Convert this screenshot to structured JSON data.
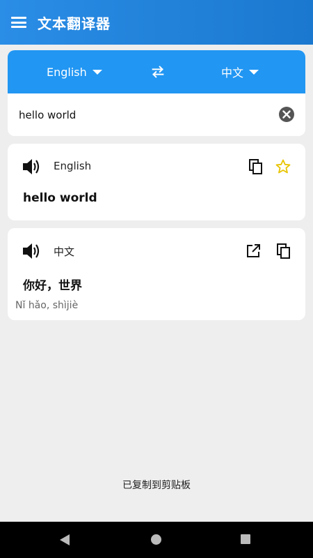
{
  "appbar": {
    "title": "文本翻译器",
    "menu_icon": "menu-icon"
  },
  "languages": {
    "source": "English",
    "target": "中文",
    "swap_icon": "swap-arrows-icon"
  },
  "input": {
    "value": "hello world",
    "clear_icon": "clear-icon"
  },
  "source_result": {
    "language": "English",
    "text": "hello world",
    "icons": [
      "speaker-icon",
      "copy-icon",
      "star-icon"
    ]
  },
  "target_result": {
    "language": "中文",
    "text": "你好，世界",
    "pinyin": "Nǐ hǎo, shìjiè",
    "icons": [
      "speaker-icon",
      "open-external-icon",
      "copy-icon"
    ]
  },
  "toast": {
    "message": "已复制到剪贴板"
  },
  "colors": {
    "primary": "#2196f3",
    "appbar": "#1b78cf",
    "star": "#e8c400"
  }
}
